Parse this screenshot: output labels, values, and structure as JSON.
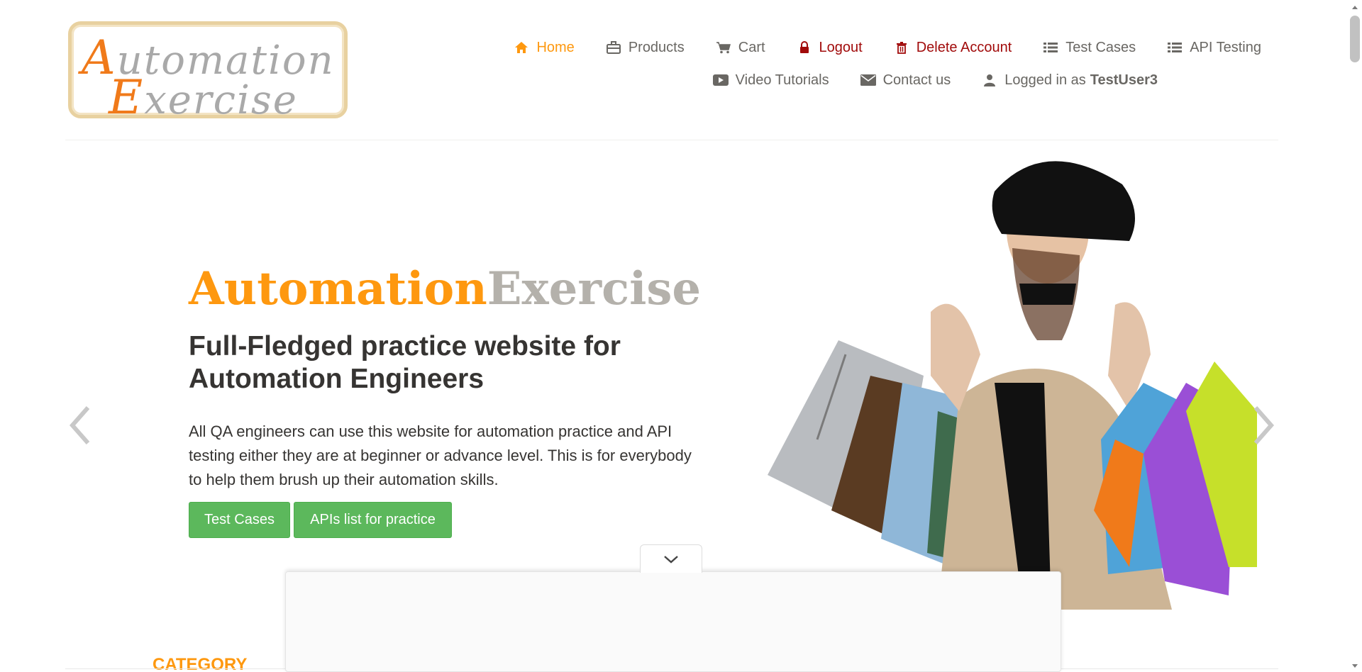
{
  "logo": {
    "line1_cap": "A",
    "line1_rest": "utomation",
    "line2_cap": "E",
    "line2_rest": "xercise"
  },
  "nav": {
    "row1": [
      {
        "icon": "home-icon",
        "label": "Home",
        "state": "active"
      },
      {
        "icon": "briefcase-icon",
        "label": "Products"
      },
      {
        "icon": "cart-icon",
        "label": "Cart"
      },
      {
        "icon": "lock-icon",
        "label": "Logout"
      },
      {
        "icon": "trash-icon",
        "label": "Delete Account"
      },
      {
        "icon": "list-icon",
        "label": "Test Cases"
      },
      {
        "icon": "list-icon",
        "label": "API Testing"
      }
    ],
    "row2": [
      {
        "icon": "video-icon",
        "label": "Video Tutorials"
      },
      {
        "icon": "envelope-icon",
        "label": "Contact us"
      },
      {
        "icon": "user-icon",
        "label": "Logged in as",
        "username": "TestUser3"
      }
    ]
  },
  "hero": {
    "title_a": "Automation",
    "title_b": "Exercise",
    "subtitle": "Full-Fledged practice website for Automation Engineers",
    "description": "All QA engineers can use this website for automation practice and API testing either they are at beginner or advance level. This is for everybody to help them brush up their automation skills.",
    "btn_test_cases": "Test Cases",
    "btn_apis": "APIs list for practice"
  },
  "sidebar": {
    "category_heading": "CATEGORY"
  },
  "colors": {
    "accent": "#fe980f",
    "danger": "#a10b0b",
    "button": "#5cb85c",
    "text": "#696763"
  }
}
